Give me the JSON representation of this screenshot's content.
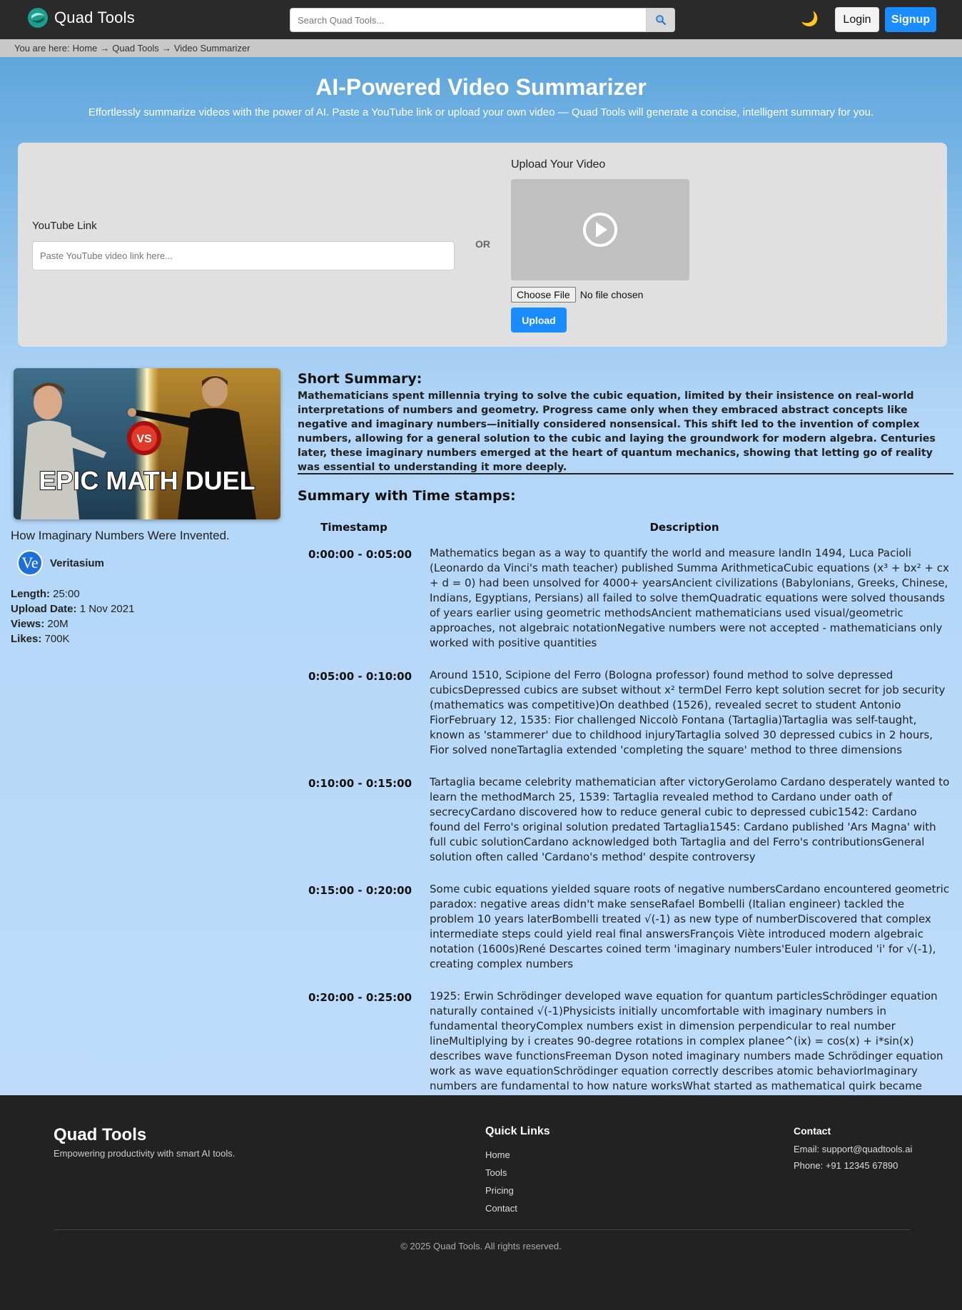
{
  "navbar": {
    "brand": "Quad Tools",
    "search_placeholder": "Search Quad Tools...",
    "login_label": "Login",
    "signup_label": "Signup",
    "theme_icon": "moon-icon"
  },
  "breadcrumb": {
    "prefix": "You are here:",
    "items": [
      "Home",
      "Quad Tools",
      "Video Summarizer"
    ],
    "separator": "→"
  },
  "hero": {
    "title": "AI-Powered Video Summarizer",
    "subtitle": "Effortlessly summarize videos with the power of AI. Paste a YouTube link or upload your own video — Quad Tools will generate a concise, intelligent summary for you."
  },
  "input_card": {
    "youtube_label": "YouTube Link",
    "youtube_placeholder": "Paste YouTube video link here...",
    "or_label": "OR",
    "upload_label": "Upload Your Video",
    "choose_file_label": "Choose File",
    "no_file_label": "No file chosen",
    "upload_button": "Upload"
  },
  "video": {
    "thumbnail_text": "EPIC MATH DUEL",
    "title": "How Imaginary Numbers Were Invented.",
    "channel_avatar": "Ve",
    "channel_name": "Veritasium",
    "length_label": "Length:",
    "length": "25:00",
    "upload_date_label": "Upload Date:",
    "upload_date": "1 Nov 2021",
    "views_label": "Views:",
    "views": "20M",
    "likes_label": "Likes:",
    "likes": "700K"
  },
  "summary": {
    "short_title": "Short Summary:",
    "short_text": "Mathematicians spent millennia trying to solve the cubic equation, limited by their insistence on real-world interpretations of numbers and geometry. Progress came only when they embraced abstract concepts like negative and imaginary numbers—initially considered nonsensical. This shift led to the invention of complex numbers, allowing for a general solution to the cubic and laying the groundwork for modern algebra. Centuries later, these imaginary numbers emerged at the heart of quantum mechanics, showing that letting go of reality was essential to understanding it more deeply.",
    "timestamps_title": "Summary with Time stamps:",
    "col_timestamp": "Timestamp",
    "col_description": "Description",
    "rows": [
      {
        "time": "0:00:00 - 0:05:00",
        "desc": "Mathematics began as a way to quantify the world and measure landIn 1494, Luca Pacioli (Leonardo da Vinci's math teacher) published Summa ArithmeticaCubic equations (x³ + bx² + cx + d = 0) had been unsolved for 4000+ yearsAncient civilizations (Babylonians, Greeks, Chinese, Indians, Egyptians, Persians) all failed to solve themQuadratic equations were solved thousands of years earlier using geometric methodsAncient mathematicians used visual/geometric approaches, not algebraic notationNegative numbers were not accepted - mathematicians only worked with positive quantities"
      },
      {
        "time": "0:05:00 - 0:10:00",
        "desc": "Around 1510, Scipione del Ferro (Bologna professor) found method to solve depressed cubicsDepressed cubics are subset without x² termDel Ferro kept solution secret for job security (mathematics was competitive)On deathbed (1526), revealed secret to student Antonio FiorFebruary 12, 1535: Fior challenged Niccolò Fontana (Tartaglia)Tartaglia was self-taught, known as 'stammerer' due to childhood injuryTartaglia solved 30 depressed cubics in 2 hours, Fior solved noneTartaglia extended 'completing the square' method to three dimensions"
      },
      {
        "time": "0:10:00 - 0:15:00",
        "desc": "Tartaglia became celebrity mathematician after victoryGerolamo Cardano desperately wanted to learn the methodMarch 25, 1539: Tartaglia revealed method to Cardano under oath of secrecyCardano discovered how to reduce general cubic to depressed cubic1542: Cardano found del Ferro's original solution predated Tartaglia1545: Cardano published 'Ars Magna' with full cubic solutionCardano acknowledged both Tartaglia and del Ferro's contributionsGeneral solution often called 'Cardano's method' despite controversy"
      },
      {
        "time": "0:15:00 - 0:20:00",
        "desc": "Some cubic equations yielded square roots of negative numbersCardano encountered geometric paradox: negative areas didn't make senseRafael Bombelli (Italian engineer) tackled the problem 10 years laterBombelli treated √(-1) as new type of numberDiscovered that complex intermediate steps could yield real final answersFrançois Viète introduced modern algebraic notation (1600s)René Descartes coined term 'imaginary numbers'Euler introduced 'i' for √(-1), creating complex numbers"
      },
      {
        "time": "0:20:00 - 0:25:00",
        "desc": "1925: Erwin Schrödinger developed wave equation for quantum particlesSchrödinger equation naturally contained √(-1)Physicists initially uncomfortable with imaginary numbers in fundamental theoryComplex numbers exist in dimension perpendicular to real number lineMultiplying by i creates 90-degree rotations in complex planee^(ix) = cos(x) + i*sin(x) describes wave functionsFreeman Dyson noted imaginary numbers made Schrödinger equation work as wave equationSchrödinger equation correctly describes atomic behaviorImaginary numbers are fundamental to how nature worksWhat started as mathematical quirk became essential to understanding reality"
      }
    ]
  },
  "footer": {
    "brand": "Quad Tools",
    "tagline": "Empowering productivity with smart AI tools.",
    "links_title": "Quick Links",
    "links": [
      "Home",
      "Tools",
      "Pricing",
      "Contact"
    ],
    "contact_title": "Contact",
    "email": "Email: support@quadtools.ai",
    "phone": "Phone: +91 12345 67890",
    "copyright": "© 2025 Quad Tools. All rights reserved."
  },
  "colors": {
    "navbar_bg": "#2a2a2a",
    "accent": "#1a8cff",
    "footer_bg": "#222222",
    "card_bg": "#e0e0e0"
  }
}
